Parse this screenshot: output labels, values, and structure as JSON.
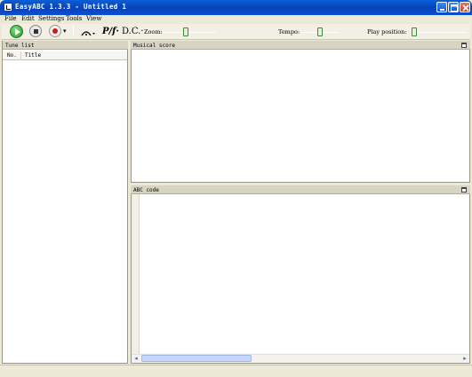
{
  "window": {
    "title": "EasyABC 1.3.3 - Untitled 1"
  },
  "menu": {
    "items": [
      "File",
      "Edit",
      "Settings",
      "Tools",
      "View"
    ]
  },
  "toolbar": {
    "play": "play",
    "stop": "stop",
    "record": "record",
    "dynamics": "P/f·",
    "dc": "D.C.·",
    "zoom_label": "Zoom:",
    "tempo_label": "Tempo:",
    "play_position_label": "Play position:",
    "zoom_level": 0.43,
    "tempo_level": 0.5,
    "play_position_level": 0.0
  },
  "tune_list": {
    "title": "Tune list",
    "columns": [
      "No.",
      "Title"
    ]
  },
  "score": {
    "title": "Musical score"
  },
  "abc": {
    "title": "ABC code"
  },
  "colors": {
    "titlebar": "#0a50d0",
    "chrome": "#ece9d8",
    "accent_green": "#1f9a1f",
    "record_red": "#d01818"
  }
}
